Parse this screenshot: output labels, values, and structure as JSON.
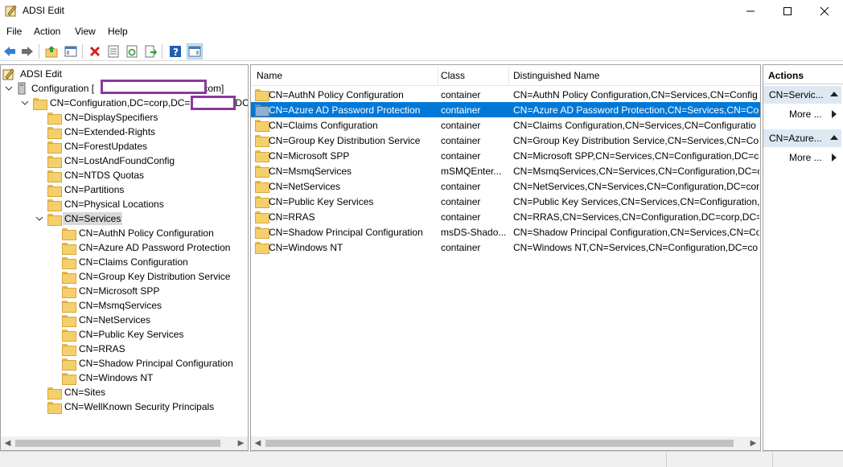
{
  "window": {
    "title": "ADSI Edit"
  },
  "menu": [
    "File",
    "Action",
    "View",
    "Help"
  ],
  "tree": {
    "root": "ADSI Edit",
    "connection_prefix": "Configuration [",
    "connection_suffix": ".com]",
    "naming_context_prefix": "CN=Configuration,DC=corp,DC=",
    "naming_context_suffix": "DC",
    "children": [
      "CN=DisplaySpecifiers",
      "CN=Extended-Rights",
      "CN=ForestUpdates",
      "CN=LostAndFoundConfig",
      "CN=NTDS Quotas",
      "CN=Partitions",
      "CN=Physical Locations",
      "CN=Services"
    ],
    "services_children": [
      "CN=AuthN Policy Configuration",
      "CN=Azure AD Password Protection",
      "CN=Claims Configuration",
      "CN=Group Key Distribution Service",
      "CN=Microsoft SPP",
      "CN=MsmqServices",
      "CN=NetServices",
      "CN=Public Key Services",
      "CN=RRAS",
      "CN=Shadow Principal Configuration",
      "CN=Windows NT"
    ],
    "after_services": [
      "CN=Sites",
      "CN=WellKnown Security Principals"
    ]
  },
  "list": {
    "columns": [
      "Name",
      "Class",
      "Distinguished Name"
    ],
    "rows": [
      {
        "name": "CN=AuthN Policy Configuration",
        "class": "container",
        "dn": "CN=AuthN Policy Configuration,CN=Services,CN=Config"
      },
      {
        "name": "CN=Azure AD Password Protection",
        "class": "container",
        "dn": "CN=Azure AD Password Protection,CN=Services,CN=Con"
      },
      {
        "name": "CN=Claims Configuration",
        "class": "container",
        "dn": "CN=Claims Configuration,CN=Services,CN=Configuratio"
      },
      {
        "name": "CN=Group Key Distribution Service",
        "class": "container",
        "dn": "CN=Group Key Distribution Service,CN=Services,CN=Con"
      },
      {
        "name": "CN=Microsoft SPP",
        "class": "container",
        "dn": "CN=Microsoft SPP,CN=Services,CN=Configuration,DC=c"
      },
      {
        "name": "CN=MsmqServices",
        "class": "mSMQEnter...",
        "dn": "CN=MsmqServices,CN=Services,CN=Configuration,DC=c"
      },
      {
        "name": "CN=NetServices",
        "class": "container",
        "dn": "CN=NetServices,CN=Services,CN=Configuration,DC=corp"
      },
      {
        "name": "CN=Public Key Services",
        "class": "container",
        "dn": "CN=Public Key Services,CN=Services,CN=Configuration,D"
      },
      {
        "name": "CN=RRAS",
        "class": "container",
        "dn": "CN=RRAS,CN=Services,CN=Configuration,DC=corp,DC=l"
      },
      {
        "name": "CN=Shadow Principal Configuration",
        "class": "msDS-Shado...",
        "dn": "CN=Shadow Principal Configuration,CN=Services,CN=Co"
      },
      {
        "name": "CN=Windows NT",
        "class": "container",
        "dn": "CN=Windows NT,CN=Services,CN=Configuration,DC=co"
      }
    ]
  },
  "actions": {
    "header": "Actions",
    "section1": "CN=Servic...",
    "section1_more": "More ...",
    "section2": "CN=Azure...",
    "section2_more": "More ..."
  },
  "colors": {
    "selection": "#0078d7",
    "redaction": "#8b3a9c",
    "actions_section_bg": "#dde8f3"
  }
}
